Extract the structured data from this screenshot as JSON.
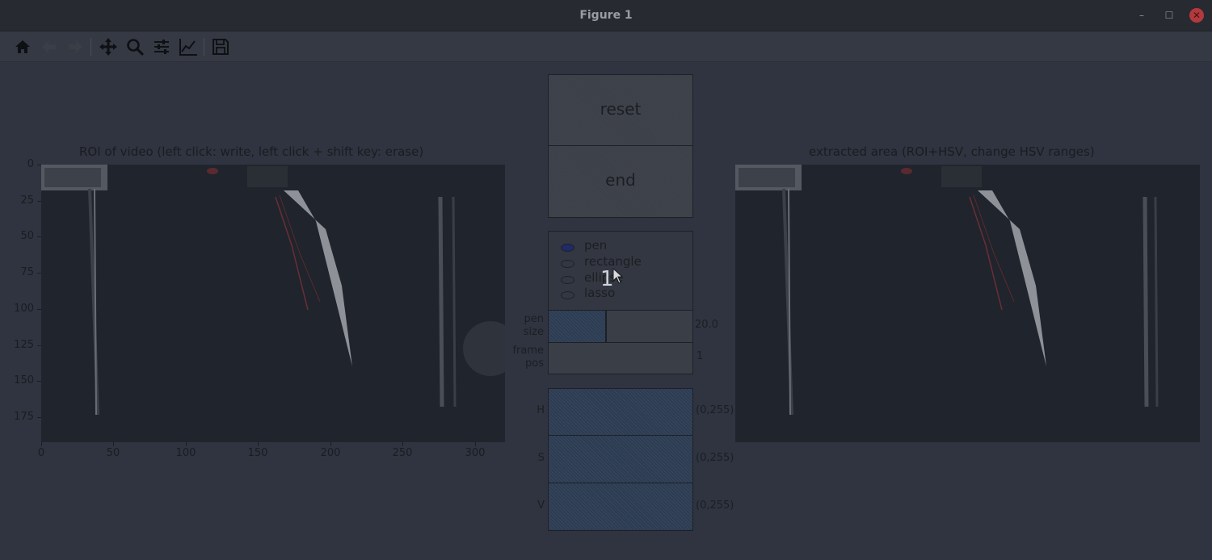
{
  "window": {
    "title": "Figure 1",
    "minimize": "–",
    "maximize": "☐",
    "close": "✕"
  },
  "toolbar": {
    "buttons": [
      {
        "name": "home-icon",
        "label": "home"
      },
      {
        "name": "back-icon",
        "label": "back"
      },
      {
        "name": "forward-icon",
        "label": "forward"
      },
      {
        "name": "pan-icon",
        "label": "pan"
      },
      {
        "name": "zoom-icon",
        "label": "zoom"
      },
      {
        "name": "configure-subplots-icon",
        "label": "configure"
      },
      {
        "name": "edit-axis-icon",
        "label": "edit"
      },
      {
        "name": "save-icon",
        "label": "save"
      }
    ]
  },
  "left_plot": {
    "title": "ROI of video (left click: write, left click + shift key: erase)",
    "yticks": [
      "0",
      "25",
      "50",
      "75",
      "100",
      "125",
      "150",
      "175"
    ],
    "xticks": [
      "0",
      "50",
      "100",
      "150",
      "200",
      "250",
      "300"
    ]
  },
  "right_plot": {
    "title": "extracted area (ROI+HSV, change HSV ranges)"
  },
  "controls": {
    "reset_label": "reset",
    "end_label": "end",
    "radio_options": [
      "pen",
      "rectangle",
      "ellipse",
      "lasso"
    ],
    "radio_selected": "pen",
    "pen_size": {
      "label_line1": "pen",
      "label_line2": "size",
      "value": "20.0",
      "fraction": 0.4
    },
    "frame_pos": {
      "label_line1": "frame",
      "label_line2": "pos",
      "value": "1",
      "fraction": 0.0
    },
    "hsv": [
      {
        "label": "H",
        "value": "(0,255)"
      },
      {
        "label": "S",
        "value": "(0,255)"
      },
      {
        "label": "V",
        "value": "(0,255)"
      }
    ]
  },
  "cursor_overlay": "1",
  "colors": {
    "background": "#2f3440",
    "titlebar": "#272a30",
    "close_button": "#b23a3e",
    "selected_radio": "#1f2a66"
  }
}
